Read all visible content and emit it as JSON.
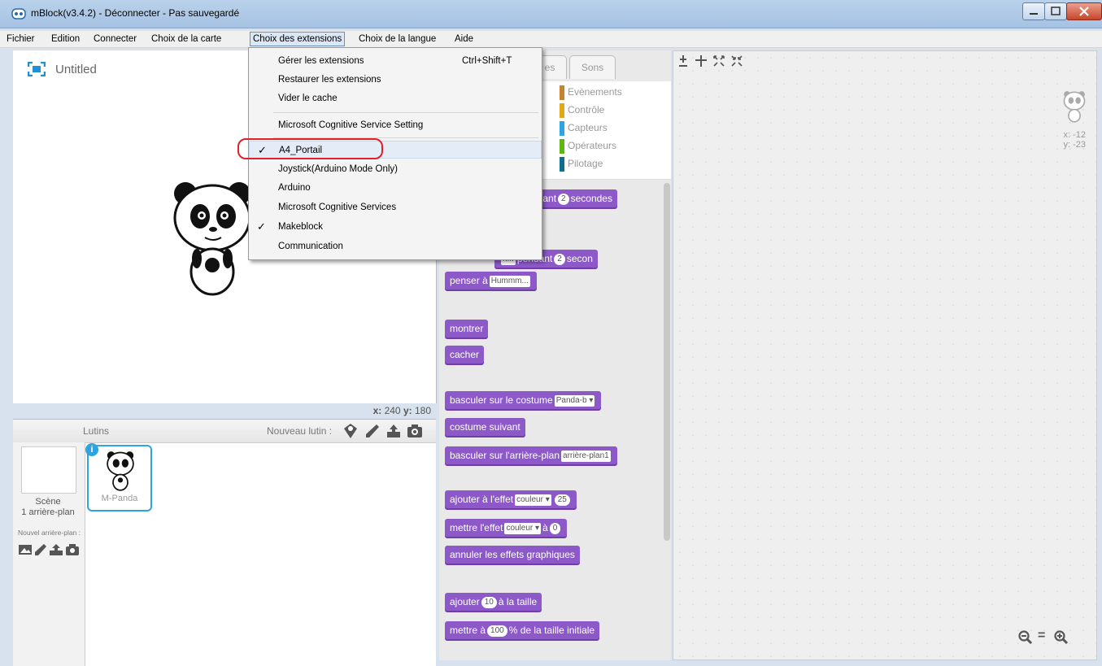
{
  "window": {
    "title": "mBlock(v3.4.2) - Déconnecter - Pas sauvegardé"
  },
  "menubar": {
    "items": [
      "Fichier",
      "Edition",
      "Connecter",
      "Choix de la carte",
      "Choix des extensions",
      "Choix de la langue",
      "Aide"
    ],
    "open_item": "Choix des extensions"
  },
  "dropdown": {
    "items": [
      {
        "label": "Gérer les extensions",
        "shortcut": "Ctrl+Shift+T"
      },
      {
        "label": "Restaurer les extensions"
      },
      {
        "label": "Vider le cache"
      },
      {
        "label": "Microsoft Cognitive Service Setting"
      },
      {
        "label": "A4_Portail",
        "checked": true
      },
      {
        "label": "Joystick(Arduino Mode Only)"
      },
      {
        "label": "Arduino"
      },
      {
        "label": "Microsoft Cognitive Services"
      },
      {
        "label": "Makeblock",
        "checked": true
      },
      {
        "label": "Communication"
      }
    ],
    "check_glyph": "✓"
  },
  "stage": {
    "project_name": "Untitled",
    "x_label": "x:",
    "x_value": "240",
    "y_label": "y:",
    "y_value": "180"
  },
  "sprites": {
    "header": "Lutins",
    "new_sprite_label": "Nouveau lutin :",
    "scene_label": "Scène",
    "scene_backdrops": "1 arrière-plan",
    "new_backdrop_label": "Nouvel arrière-plan :",
    "selected_sprite": "M-Panda",
    "info_badge": "i"
  },
  "tabs": {
    "partial_tab": "es",
    "sounds_tab": "Sons"
  },
  "categories": [
    {
      "name": "Evènements",
      "color": "#c88330"
    },
    {
      "name": "Contrôle",
      "color": "#e1a91a"
    },
    {
      "name": "Capteurs",
      "color": "#2ca5e2"
    },
    {
      "name": "Opérateurs",
      "color": "#5cb712"
    },
    {
      "name": "Pilotage",
      "color": "#0e6e8c"
    }
  ],
  "blocks": {
    "b1_text": "ndant",
    "b1_num": "2",
    "b1_suffix": "secondes",
    "b2_slot": "n...",
    "b2_text": "pendant",
    "b2_num": "2",
    "b2_suffix": "secon",
    "b3_text": "penser à",
    "b3_slot": "Hummm...",
    "b4_text": "montrer",
    "b5_text": "cacher",
    "b6_text": "basculer sur le costume",
    "b6_slot": "Panda-b ▾",
    "b7_text": "costume suivant",
    "b8_text": "basculer sur l'arrière-plan",
    "b8_slot": "arrière-plan1",
    "b9_text": "ajouter à l'effet",
    "b9_slot": "couleur ▾",
    "b9_num": "25",
    "b10_text": "mettre l'effet",
    "b10_slot": "couleur ▾",
    "b10_mid": "à",
    "b10_num": "0",
    "b11_text": "annuler les effets graphiques",
    "b12_text": "ajouter",
    "b12_num": "10",
    "b12_suffix": "à la taille",
    "b13_text": "mettre à",
    "b13_num": "100",
    "b13_suffix": "% de la taille initiale"
  },
  "script_area": {
    "sprite_x": "x: -12",
    "sprite_y": "y: -23",
    "zoom_reset": "="
  },
  "colors": {
    "block_purple": "#8d59c9",
    "highlight_ring": "#e0202a",
    "title_bar": "#b9d1ea"
  }
}
